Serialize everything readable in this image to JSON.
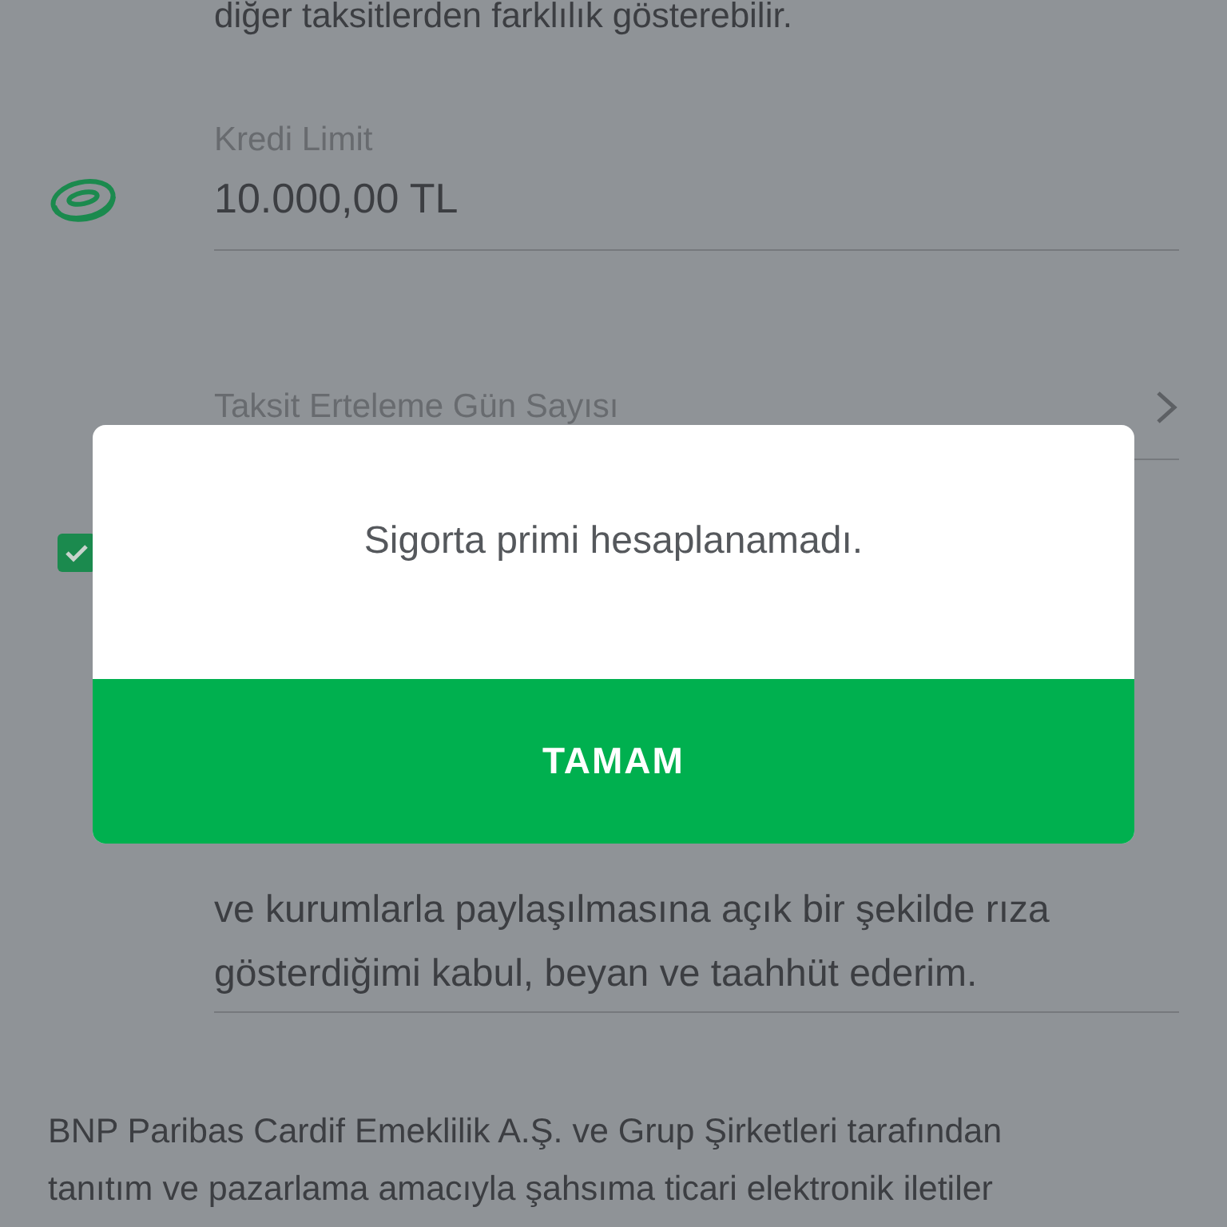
{
  "page": {
    "note": "diğer taksitlerden farklılık gösterebilir.",
    "credit_limit": {
      "label": "Kredi Limit",
      "value": "10.000,00 TL"
    },
    "deferral": {
      "label": "Taksit Erteleme Gün Sayısı"
    },
    "consent": {
      "checked": true,
      "lines": [
        "ve kurumlarla paylaşılmasına açık bir şekilde rıza",
        "gösterdiğimi kabul, beyan ve taahhüt ederim."
      ]
    },
    "footer_lines": [
      "BNP Paribas Cardif Emeklilik A.Ş. ve Grup Şirketleri tarafından",
      "tanıtım ve pazarlama amacıyla şahsıma ticari elektronik iletiler"
    ]
  },
  "dialog": {
    "message": "Sigorta primi hesaplanamadı.",
    "button": "TAMAM"
  }
}
